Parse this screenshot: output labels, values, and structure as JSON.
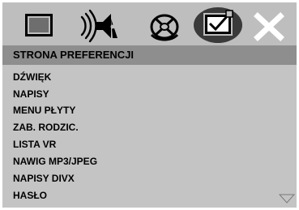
{
  "icons": [
    "tv-screen-icon",
    "speaker-sound-icon",
    "disc-icon",
    "preference-check-icon",
    "close-icon"
  ],
  "selected_icon": "preference-check-icon",
  "header": {
    "title": "STRONA PREFERENCJI"
  },
  "menu": {
    "items": [
      {
        "label": "DŹWIĘK"
      },
      {
        "label": "NAPISY"
      },
      {
        "label": "MENU PŁYTY"
      },
      {
        "label": "ZAB. RODZIC."
      },
      {
        "label": "LISTA VR"
      },
      {
        "label": "NAWIG MP3/JPEG"
      },
      {
        "label": "NAPISY DIVX"
      },
      {
        "label": "HASŁO"
      }
    ]
  },
  "scroll_hint_icon": "scroll-down-triangle-icon",
  "colors": {
    "icon_bar": "#bebebe",
    "header_bg": "#8e8e8e",
    "menu_bg": "#c4c4c4",
    "text": "#000000"
  }
}
